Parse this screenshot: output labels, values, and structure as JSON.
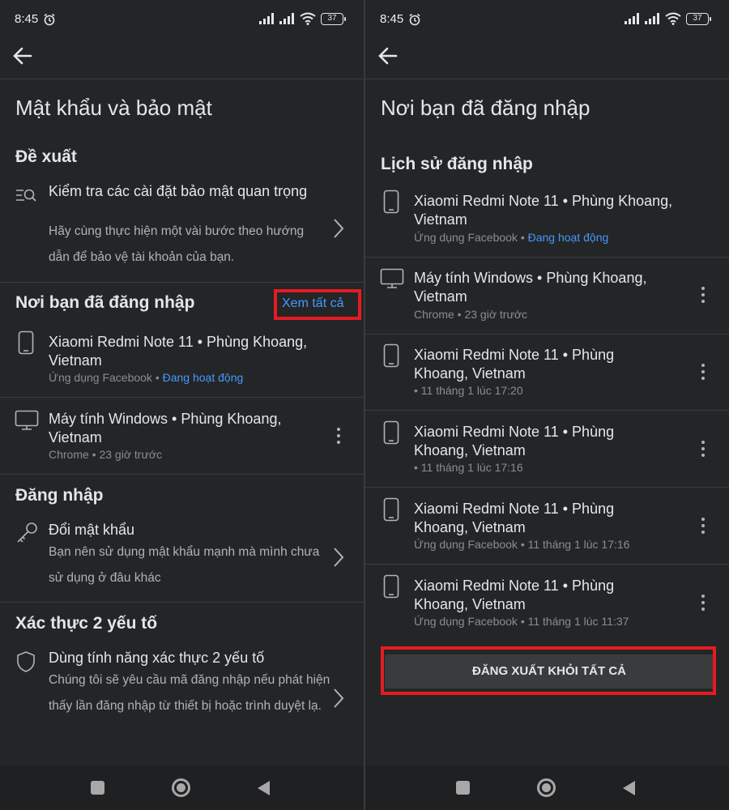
{
  "status_bar": {
    "time": "8:45",
    "battery": "37"
  },
  "left": {
    "title": "Mật khẩu và bảo mật",
    "suggest": {
      "heading": "Đề xuất",
      "item_title": "Kiểm tra các cài đặt bảo mật quan trọng",
      "item_desc": "Hãy cùng thực hiện một vài bước theo hướng dẫn để bảo vệ tài khoản của bạn."
    },
    "where": {
      "heading": "Nơi bạn đã đăng nhập",
      "see_all": "Xem tất cả",
      "devices": [
        {
          "title": "Xiaomi Redmi Note 11 • Phùng Khoang, Vietnam",
          "meta": "Ứng dụng Facebook",
          "active": "Đang hoạt động"
        },
        {
          "title": "Máy tính Windows • Phùng Khoang, Vietnam",
          "meta": "Chrome • 23 giờ trước"
        }
      ]
    },
    "login": {
      "heading": "Đăng nhập",
      "item_title": "Đổi mật khẩu",
      "item_desc": "Bạn nên sử dụng mật khẩu mạnh mà mình chưa sử dụng ở đâu khác"
    },
    "twofa": {
      "heading": "Xác thực 2 yếu tố",
      "item_title": "Dùng tính năng xác thực 2 yếu tố",
      "item_desc": "Chúng tôi sẽ yêu cầu mã đăng nhập nếu phát hiện thấy lần đăng nhập từ thiết bị hoặc trình duyệt lạ."
    }
  },
  "right": {
    "title": "Nơi bạn đã đăng nhập",
    "history_heading": "Lịch sử đăng nhập",
    "devices": [
      {
        "line1": "Xiaomi Redmi Note 11 • Phùng Khoang,",
        "line2": "Vietnam",
        "meta": "Ứng dụng Facebook",
        "active": "Đang hoạt động"
      },
      {
        "line1": "Máy tính Windows • Phùng Khoang,",
        "line2": "Vietnam",
        "meta": "Chrome • 23 giờ trước"
      },
      {
        "line1": "Xiaomi Redmi Note 11 • Phùng",
        "line2": "Khoang, Vietnam",
        "meta": " • 11 tháng 1 lúc 17:20"
      },
      {
        "line1": "Xiaomi Redmi Note 11 • Phùng",
        "line2": "Khoang, Vietnam",
        "meta": " • 11 tháng 1 lúc 17:16"
      },
      {
        "line1": "Xiaomi Redmi Note 11 • Phùng",
        "line2": "Khoang, Vietnam",
        "meta": "Ứng dụng Facebook • 11 tháng 1 lúc 17:16"
      },
      {
        "line1": "Xiaomi Redmi Note 11 • Phùng",
        "line2": "Khoang, Vietnam",
        "meta": "Ứng dụng Facebook • 11 tháng 1 lúc 11:37"
      }
    ],
    "logout_all": "ĐĂNG XUẤT KHỎI TẤT CẢ"
  },
  "colors": {
    "background": "#242526",
    "accent": "#4599ff",
    "highlight": "#e41b23"
  }
}
